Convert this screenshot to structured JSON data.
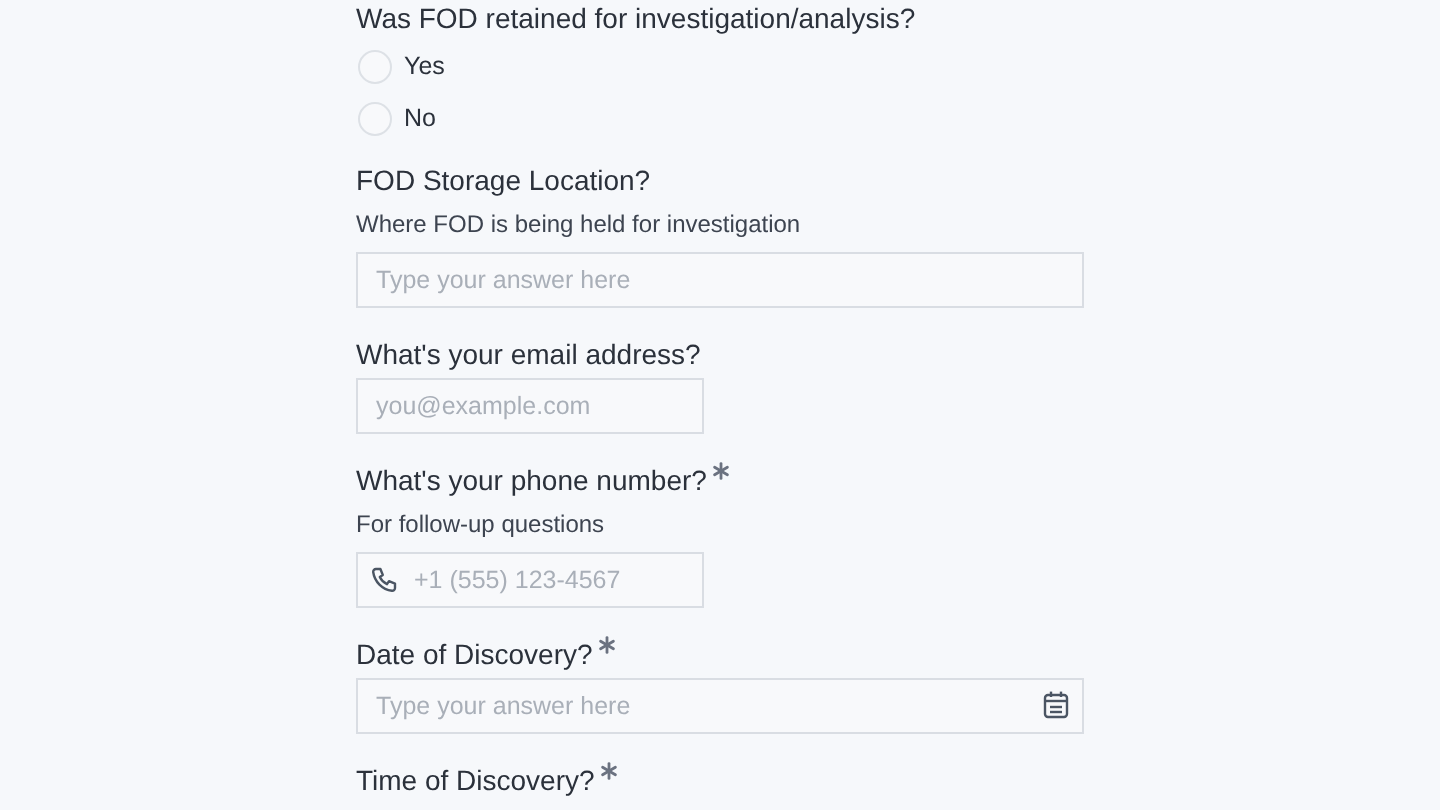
{
  "questions": [
    {
      "kind": "radio",
      "label": "Was FOD retained for investigation/analysis?",
      "required": false,
      "options": [
        {
          "label": "Yes",
          "selected": false
        },
        {
          "label": "No",
          "selected": false
        }
      ]
    },
    {
      "kind": "text",
      "label": "FOD Storage Location?",
      "required": false,
      "helper": "Where FOD is being held for investigation",
      "placeholder": "Type your answer here"
    },
    {
      "kind": "email",
      "label": "What's your email address?",
      "required": false,
      "placeholder": "you@example.com"
    },
    {
      "kind": "phone",
      "label": "What's your phone number?",
      "required": true,
      "helper": "For follow-up questions",
      "placeholder": "+1 (555) 123-4567"
    },
    {
      "kind": "date",
      "label": "Date of Discovery?",
      "required": true,
      "placeholder": "Type your answer here"
    },
    {
      "kind": "time",
      "label": "Time of Discovery?",
      "required": true
    }
  ]
}
